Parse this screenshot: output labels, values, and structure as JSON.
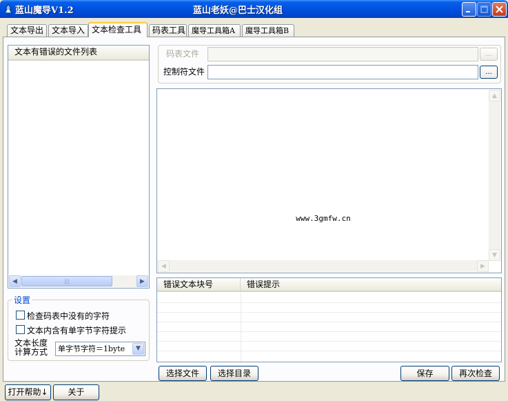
{
  "window": {
    "app_title": "蓝山魔导V1.2",
    "subtitle": "蓝山老妖@巴士汉化组"
  },
  "tabs": [
    {
      "label": "文本导出"
    },
    {
      "label": "文本导入"
    },
    {
      "label": "文本检查工具"
    },
    {
      "label": "码表工具"
    },
    {
      "label": "魔导工具箱A"
    },
    {
      "label": "魔导工具箱B"
    }
  ],
  "active_tab": "文本检查工具",
  "file_list": {
    "header": "文本有错误的文件列表"
  },
  "settings": {
    "title": "设置",
    "check_missing_chars": {
      "label": "检查码表中没有的字符",
      "checked": false
    },
    "single_byte_hint": {
      "label": "文本内含有单字节字符提示",
      "checked": false
    },
    "length_label_line1": "文本长度",
    "length_label_line2": "计算方式",
    "length_mode": "单字节字符＝1byte"
  },
  "inputs": {
    "code_table_label": "码表文件",
    "code_table_value": "",
    "control_file_label": "控制符文件",
    "control_file_value": "",
    "browse_label": "..."
  },
  "text_view": {
    "content": "www.3gmfw.cn"
  },
  "error_table": {
    "columns": [
      "错误文本块号",
      "错误提示"
    ],
    "rows": []
  },
  "buttons": {
    "select_file": "选择文件",
    "select_dir": "选择目录",
    "save": "保存",
    "recheck": "再次检查",
    "help": "打开帮助↓",
    "about": "关于"
  }
}
